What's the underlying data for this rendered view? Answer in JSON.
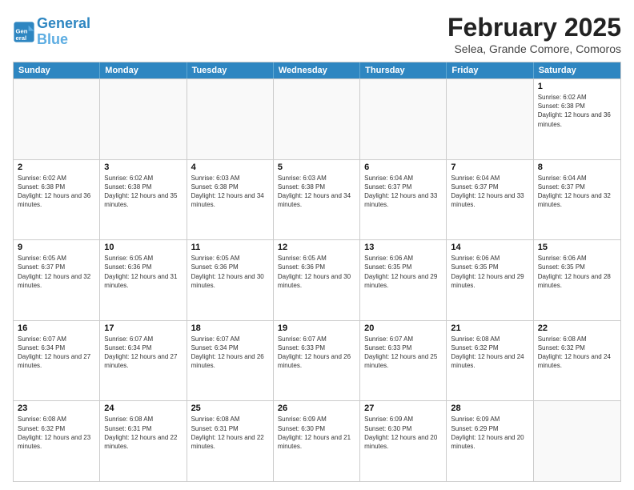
{
  "header": {
    "logo_line1": "General",
    "logo_line2": "Blue",
    "title": "February 2025",
    "subtitle": "Selea, Grande Comore, Comoros"
  },
  "days_of_week": [
    "Sunday",
    "Monday",
    "Tuesday",
    "Wednesday",
    "Thursday",
    "Friday",
    "Saturday"
  ],
  "weeks": [
    [
      {
        "day": "",
        "empty": true
      },
      {
        "day": "",
        "empty": true
      },
      {
        "day": "",
        "empty": true
      },
      {
        "day": "",
        "empty": true
      },
      {
        "day": "",
        "empty": true
      },
      {
        "day": "",
        "empty": true
      },
      {
        "day": "1",
        "sunrise": "6:02 AM",
        "sunset": "6:38 PM",
        "daylight": "12 hours and 36 minutes."
      }
    ],
    [
      {
        "day": "2",
        "sunrise": "6:02 AM",
        "sunset": "6:38 PM",
        "daylight": "12 hours and 36 minutes."
      },
      {
        "day": "3",
        "sunrise": "6:02 AM",
        "sunset": "6:38 PM",
        "daylight": "12 hours and 35 minutes."
      },
      {
        "day": "4",
        "sunrise": "6:03 AM",
        "sunset": "6:38 PM",
        "daylight": "12 hours and 34 minutes."
      },
      {
        "day": "5",
        "sunrise": "6:03 AM",
        "sunset": "6:38 PM",
        "daylight": "12 hours and 34 minutes."
      },
      {
        "day": "6",
        "sunrise": "6:04 AM",
        "sunset": "6:37 PM",
        "daylight": "12 hours and 33 minutes."
      },
      {
        "day": "7",
        "sunrise": "6:04 AM",
        "sunset": "6:37 PM",
        "daylight": "12 hours and 33 minutes."
      },
      {
        "day": "8",
        "sunrise": "6:04 AM",
        "sunset": "6:37 PM",
        "daylight": "12 hours and 32 minutes."
      }
    ],
    [
      {
        "day": "9",
        "sunrise": "6:05 AM",
        "sunset": "6:37 PM",
        "daylight": "12 hours and 32 minutes."
      },
      {
        "day": "10",
        "sunrise": "6:05 AM",
        "sunset": "6:36 PM",
        "daylight": "12 hours and 31 minutes."
      },
      {
        "day": "11",
        "sunrise": "6:05 AM",
        "sunset": "6:36 PM",
        "daylight": "12 hours and 30 minutes."
      },
      {
        "day": "12",
        "sunrise": "6:05 AM",
        "sunset": "6:36 PM",
        "daylight": "12 hours and 30 minutes."
      },
      {
        "day": "13",
        "sunrise": "6:06 AM",
        "sunset": "6:35 PM",
        "daylight": "12 hours and 29 minutes."
      },
      {
        "day": "14",
        "sunrise": "6:06 AM",
        "sunset": "6:35 PM",
        "daylight": "12 hours and 29 minutes."
      },
      {
        "day": "15",
        "sunrise": "6:06 AM",
        "sunset": "6:35 PM",
        "daylight": "12 hours and 28 minutes."
      }
    ],
    [
      {
        "day": "16",
        "sunrise": "6:07 AM",
        "sunset": "6:34 PM",
        "daylight": "12 hours and 27 minutes."
      },
      {
        "day": "17",
        "sunrise": "6:07 AM",
        "sunset": "6:34 PM",
        "daylight": "12 hours and 27 minutes."
      },
      {
        "day": "18",
        "sunrise": "6:07 AM",
        "sunset": "6:34 PM",
        "daylight": "12 hours and 26 minutes."
      },
      {
        "day": "19",
        "sunrise": "6:07 AM",
        "sunset": "6:33 PM",
        "daylight": "12 hours and 26 minutes."
      },
      {
        "day": "20",
        "sunrise": "6:07 AM",
        "sunset": "6:33 PM",
        "daylight": "12 hours and 25 minutes."
      },
      {
        "day": "21",
        "sunrise": "6:08 AM",
        "sunset": "6:32 PM",
        "daylight": "12 hours and 24 minutes."
      },
      {
        "day": "22",
        "sunrise": "6:08 AM",
        "sunset": "6:32 PM",
        "daylight": "12 hours and 24 minutes."
      }
    ],
    [
      {
        "day": "23",
        "sunrise": "6:08 AM",
        "sunset": "6:32 PM",
        "daylight": "12 hours and 23 minutes."
      },
      {
        "day": "24",
        "sunrise": "6:08 AM",
        "sunset": "6:31 PM",
        "daylight": "12 hours and 22 minutes."
      },
      {
        "day": "25",
        "sunrise": "6:08 AM",
        "sunset": "6:31 PM",
        "daylight": "12 hours and 22 minutes."
      },
      {
        "day": "26",
        "sunrise": "6:09 AM",
        "sunset": "6:30 PM",
        "daylight": "12 hours and 21 minutes."
      },
      {
        "day": "27",
        "sunrise": "6:09 AM",
        "sunset": "6:30 PM",
        "daylight": "12 hours and 20 minutes."
      },
      {
        "day": "28",
        "sunrise": "6:09 AM",
        "sunset": "6:29 PM",
        "daylight": "12 hours and 20 minutes."
      },
      {
        "day": "",
        "empty": true
      }
    ]
  ]
}
